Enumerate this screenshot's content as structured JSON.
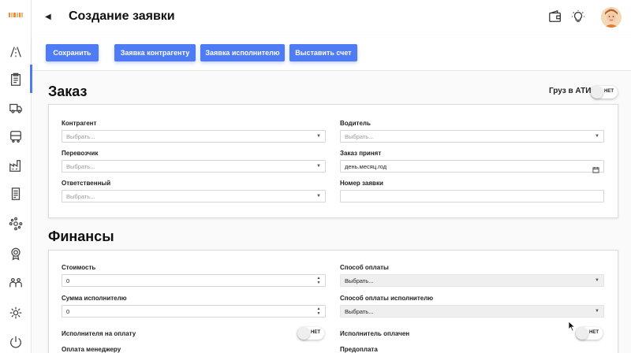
{
  "header": {
    "title": "Создание заявки",
    "back_icon": "back-arrow-icon",
    "icons": [
      "wallet-icon",
      "lightbulb-icon"
    ]
  },
  "sidebar": {
    "items": [
      {
        "name": "logo"
      },
      {
        "icon": "road-icon"
      },
      {
        "icon": "clipboard-icon",
        "active": true
      },
      {
        "icon": "truck-icon"
      },
      {
        "icon": "bus-icon"
      },
      {
        "icon": "factory-icon"
      },
      {
        "icon": "document-icon"
      },
      {
        "icon": "network-icon"
      },
      {
        "icon": "medal-icon"
      },
      {
        "icon": "team-icon"
      },
      {
        "icon": "settings-icon"
      },
      {
        "icon": "power-icon"
      }
    ]
  },
  "toolbar": {
    "save_label": "Сохранить",
    "counterparty_request_label": "Заявка контрагенту",
    "executor_request_label": "Заявка исполнителю",
    "invoice_label": "Выставить счет"
  },
  "order": {
    "title": "Заказ",
    "cargo_ati_label": "Груз в АТИ",
    "cargo_ati_toggle": "НЕТ",
    "counterparty_label": "Контрагент",
    "counterparty_placeholder": "Выбрать...",
    "carrier_label": "Перевозчик",
    "carrier_placeholder": "Выбрать...",
    "responsible_label": "Ответственный",
    "responsible_placeholder": "Выбрать...",
    "driver_label": "Водитель",
    "driver_placeholder": "Выбрать...",
    "accepted_label": "Заказ принят",
    "accepted_placeholder": "день.месяц.год",
    "request_number_label": "Номер заявки",
    "request_number_value": ""
  },
  "finance": {
    "title": "Финансы",
    "cost_label": "Стоимость",
    "cost_value": "0",
    "executor_sum_label": "Сумма исполнителю",
    "executor_sum_value": "0",
    "payment_method_label": "Способ оплаты",
    "payment_method_value": "Выбрать...",
    "executor_payment_method_label": "Способ оплаты исполнителю",
    "executor_payment_method_value": "Выбрать...",
    "executor_to_pay_label": "Исполнителя на оплату",
    "executor_to_pay_toggle": "НЕТ",
    "executor_paid_label": "Исполнитель оплачен",
    "executor_paid_toggle": "НЕТ",
    "manager_payment_label": "Оплата менеджеру",
    "prepayment_label": "Предоплата"
  }
}
